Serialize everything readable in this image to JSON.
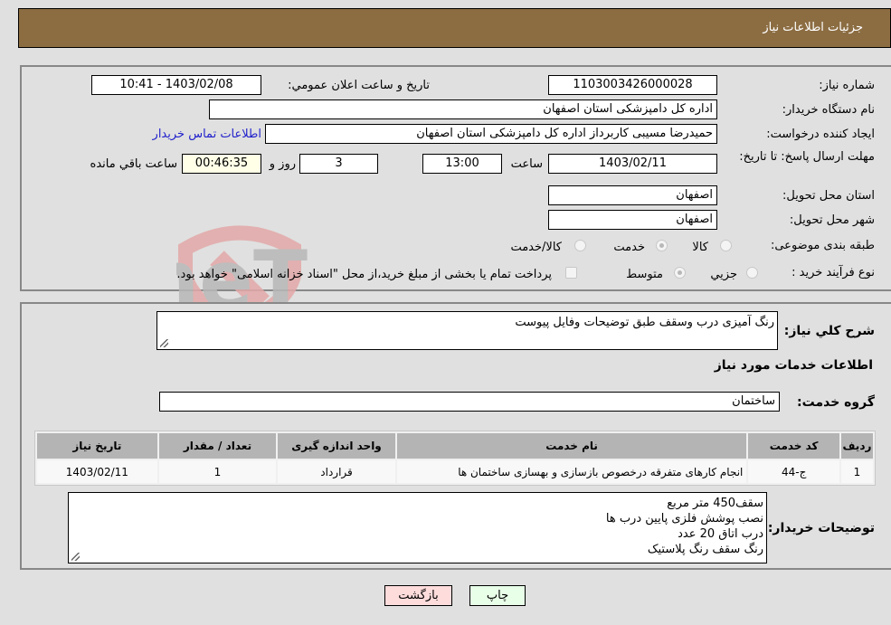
{
  "header": {
    "title": "جزئیات اطلاعات نیاز"
  },
  "form": {
    "need_number": {
      "label": "شماره نیاز:",
      "value": "1103003426000028"
    },
    "announce_datetime": {
      "label": "تاریخ و ساعت اعلان عمومي:",
      "value": "1403/02/08 - 10:41"
    },
    "buyer_org": {
      "label": "نام دستگاه خریدار:",
      "value": "اداره کل دامپزشکی استان اصفهان"
    },
    "requester": {
      "label": "ایجاد کننده درخواست:",
      "value": "حمیدرضا مسیبی کاربرداز اداره کل دامپزشکی استان اصفهان"
    },
    "buyer_contact_link": "اطلاعات تماس خریدار",
    "deadline": {
      "label": "مهلت ارسال پاسخ: تا تاریخ:",
      "date": "1403/02/11",
      "time_label": "ساعت",
      "time": "13:00",
      "days": "3",
      "days_label": "روز و",
      "remaining": "00:46:35",
      "remaining_label": "ساعت باقي مانده"
    },
    "delivery_province": {
      "label": "استان محل تحویل:",
      "value": "اصفهان"
    },
    "delivery_city": {
      "label": "شهر محل تحویل:",
      "value": "اصفهان"
    },
    "category": {
      "label": "طبقه بندی موضوعی:",
      "options": [
        "کالا",
        "خدمت",
        "کالا/خدمت"
      ],
      "selected": "خدمت"
    },
    "purchase_type": {
      "label": "نوع فرآیند خرید :",
      "options": [
        "جزيي",
        "متوسط"
      ],
      "selected": "متوسط",
      "treasury_note": "پرداخت تمام یا بخشی از مبلغ خرید،از محل \"اسناد خزانه اسلامی\" خواهد بود."
    }
  },
  "details": {
    "general_desc": {
      "label": "شرح كلي نياز:",
      "value": "رنگ آمیزی درب وسقف طبق توضیحات وفایل پیوست"
    },
    "services_title": "اطلاعات خدمات مورد نیاز",
    "service_group": {
      "label": "گروه خدمت:",
      "value": "ساختمان"
    },
    "table": {
      "headers": [
        "ردیف",
        "کد خدمت",
        "نام خدمت",
        "واحد اندازه گیری",
        "تعداد / مقدار",
        "تاریخ نیاز"
      ],
      "rows": [
        [
          "1",
          "ج-44",
          "انجام کارهای متفرقه درخصوص بازسازی و بهسازی ساختمان ها",
          "قرارداد",
          "1",
          "1403/02/11"
        ]
      ]
    },
    "buyer_notes": {
      "label": "توضیحات خریدار:",
      "lines": [
        "سقف450 متر مربع",
        "نصب پوشش فلزی پایین درب ها",
        "درب اتاق 20 عدد",
        "رنگ سقف رنگ پلاستیک"
      ]
    }
  },
  "buttons": {
    "print": "چاپ",
    "back": "بازگشت"
  },
  "watermark": {
    "text": "AriaTender.neT"
  }
}
